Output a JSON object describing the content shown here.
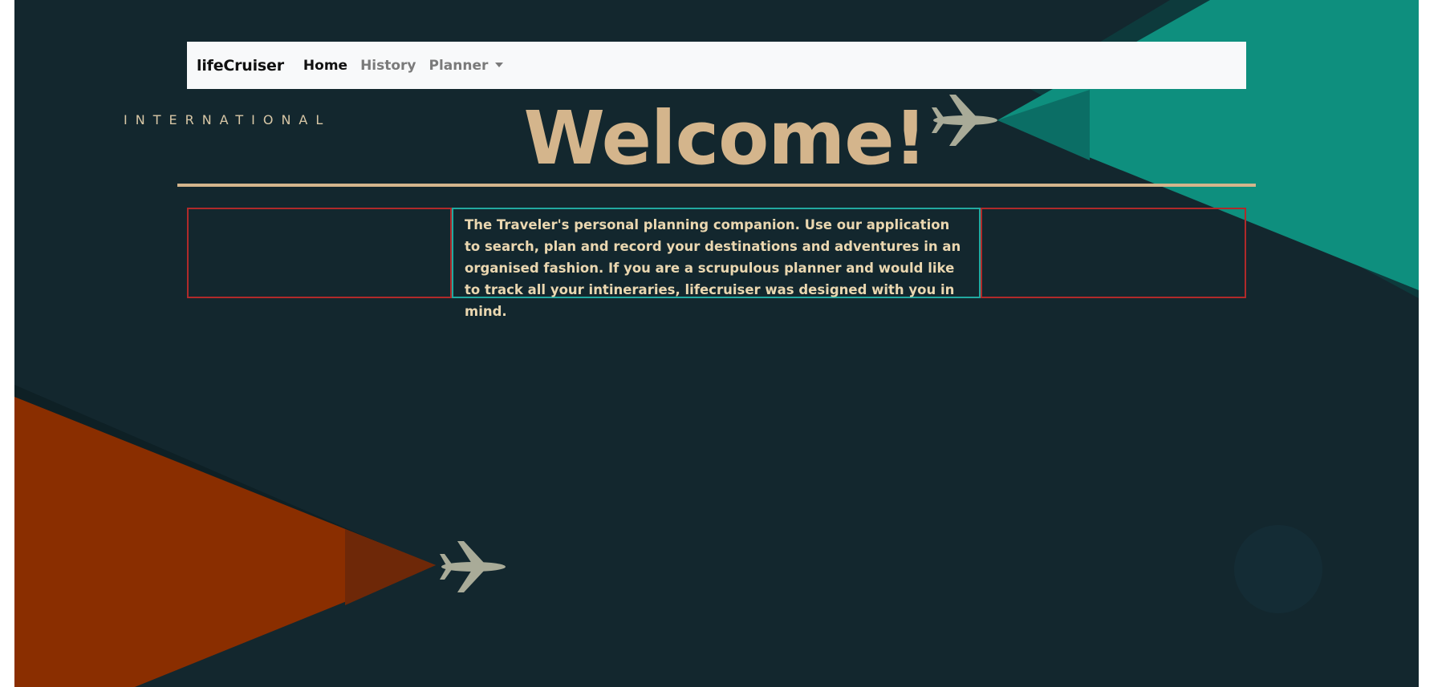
{
  "navbar": {
    "brand": "lifeCruiser",
    "links": [
      {
        "label": "Home",
        "active": true
      },
      {
        "label": "History",
        "active": false
      },
      {
        "label": "Planner",
        "active": false,
        "dropdown": true
      }
    ]
  },
  "hero": {
    "tag": "INTERNATIONAL",
    "title": "Welcome!",
    "intro": "The Traveler's personal planning companion. Use our application to search, plan and record your destinations and adventures in an organised fashion. If you are a scrupulous planner and would like to track all your intineraries, lifecruiser was designed with you in mind."
  },
  "decor": {
    "icons": [
      "airplane-icon",
      "airplane-icon"
    ],
    "colors": {
      "background": "#13272e",
      "teal": "#0e8f7e",
      "orange": "#8a2e00",
      "accent_tan": "#d4b58c",
      "box_red": "#b02a2a",
      "box_teal": "#22a9a0"
    }
  }
}
